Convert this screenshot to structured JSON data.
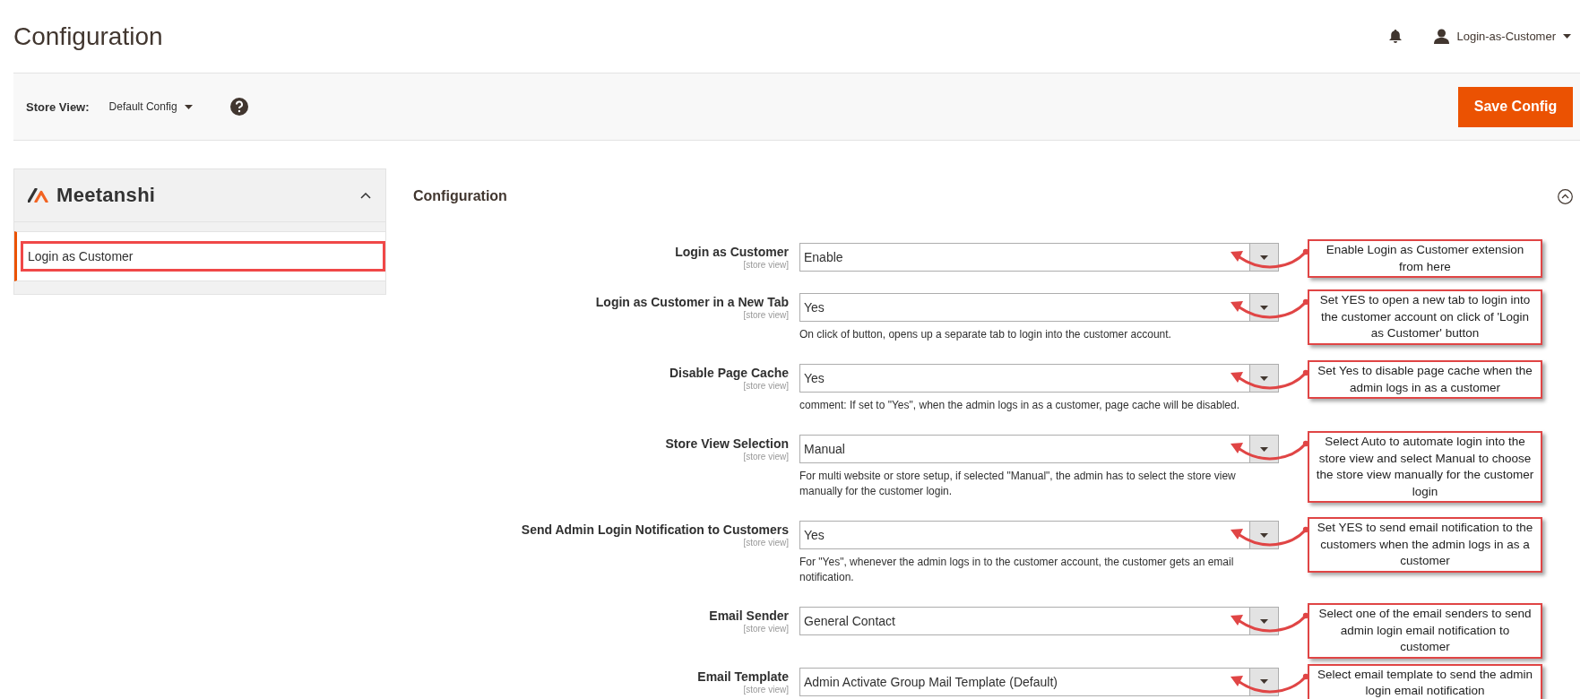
{
  "header": {
    "title": "Configuration",
    "user": "Login-as-Customer"
  },
  "scope_bar": {
    "label": "Store View:",
    "value": "Default Config",
    "button": "Save Config"
  },
  "sidebar": {
    "brand": "Meetanshi",
    "expanded": true,
    "items": [
      {
        "label": "Login as Customer",
        "selected": true,
        "highlighted": true
      }
    ]
  },
  "section": {
    "title": "Configuration",
    "expanded": true,
    "fields": [
      {
        "label": "Login as Customer",
        "scope": "[store view]",
        "value": "Enable",
        "annotation": "Enable Login as Customer extension from here"
      },
      {
        "label": "Login as Customer in a New Tab",
        "scope": "[store view]",
        "value": "Yes",
        "note": "On click of button, opens up a separate tab to login into the customer account.",
        "annotation": "Set YES to open a new tab to login into the customer account on click of 'Login as Customer' button"
      },
      {
        "label": "Disable Page Cache",
        "scope": "[store view]",
        "value": "Yes",
        "note": "comment: If set to \"Yes\", when the admin logs in as a customer, page cache will be disabled.",
        "annotation": "Set Yes to disable page cache when the admin logs in as a customer"
      },
      {
        "label": "Store View Selection",
        "scope": "[store view]",
        "value": "Manual",
        "note": "For multi website or store setup, if selected \"Manual\", the admin has to select the store view manually for the customer login.",
        "annotation": "Select Auto to automate login into the store view and select Manual to choose the store view manually for the customer login"
      },
      {
        "label": "Send Admin Login Notification to Customers",
        "scope": "[store view]",
        "value": "Yes",
        "note": "For \"Yes\", whenever the admin logs in to the customer account, the customer gets an email notification.",
        "annotation": "Set YES to send email notification to the customers when the admin logs in as a customer"
      },
      {
        "label": "Email Sender",
        "scope": "[store view]",
        "value": "General Contact",
        "annotation": "Select one of the email senders to send admin login email notification to customer"
      },
      {
        "label": "Email Template",
        "scope": "[store view]",
        "value": "Admin Activate Group Mail Template (Default)",
        "annotation": "Select email template to send the admin login email notification"
      }
    ]
  }
}
